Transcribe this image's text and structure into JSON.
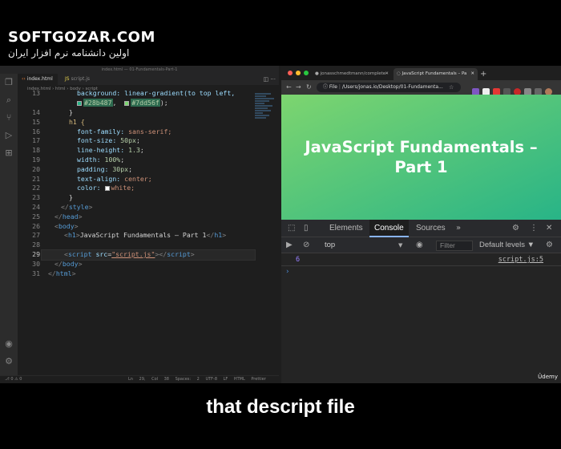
{
  "watermark": {
    "title": "SOFTGOZAR.COM",
    "subtitle": "اولین دانشنامه نرم افزار ایران"
  },
  "editor": {
    "window_title": "index.html — 01-Fundamentals-Part-1",
    "tabs": [
      {
        "label": "index.html",
        "active": true
      },
      {
        "label": "script.js",
        "active": false
      }
    ],
    "breadcrumb": "index.html  ›  html  ›  body  ›  script",
    "lines": [
      {
        "n": "13"
      },
      {
        "n": "14"
      },
      {
        "n": "15"
      },
      {
        "n": "16"
      },
      {
        "n": "17"
      },
      {
        "n": "18"
      },
      {
        "n": "19"
      },
      {
        "n": "20"
      },
      {
        "n": "21"
      },
      {
        "n": "22"
      },
      {
        "n": "23"
      },
      {
        "n": "24"
      },
      {
        "n": "25"
      },
      {
        "n": "26"
      },
      {
        "n": "27"
      },
      {
        "n": "28"
      },
      {
        "n": "29"
      },
      {
        "n": "30"
      },
      {
        "n": "31"
      }
    ],
    "code": {
      "l13a": "background: linear-gradient(to top left,",
      "l13b_c1": "#28b487",
      "l13b_c2": "#7dd56f",
      "l14": "}",
      "l15": "h1 {",
      "l16_p": "font-family: ",
      "l16_v": "sans-serif;",
      "l17_p": "font-size: ",
      "l17_v": "50px",
      "l18_p": "line-height: ",
      "l18_v": "1.3",
      "l19_p": "width: ",
      "l19_v": "100%",
      "l20_p": "padding: ",
      "l20_v": "30px",
      "l21_p": "text-align: ",
      "l21_v": "center;",
      "l22_p": "color: ",
      "l22_v": "white;",
      "l23": "}",
      "l24": "style",
      "l25": "head",
      "l26": "body",
      "l27_tag": "h1",
      "l27_txt": "JavaScript Fundamentals – Part 1",
      "l29_tag": "script",
      "l29_attr": "src",
      "l29_val": "\"script.js\"",
      "l30": "body",
      "l31": "html"
    },
    "status": {
      "left": "⎇ 0 ⚠ 0",
      "right": "Ln 29, Col 38  Spaces: 2  UTF-8  LF  HTML  Prettier"
    }
  },
  "browser": {
    "tabs": [
      {
        "label": "jonasschmedtmann/complete-"
      },
      {
        "label": "JavaScript Fundamentals – Pa"
      }
    ],
    "url_prefix": "File",
    "url": "/Users/jonas.io/Desktop/01-Fundamenta...",
    "page_heading": "JavaScript Fundamentals – Part 1",
    "colors": {
      "gradient_start": "#28b487",
      "gradient_end": "#7dd56f"
    }
  },
  "devtools": {
    "tabs": [
      "Elements",
      "Console",
      "Sources"
    ],
    "active_tab": "Console",
    "context": "top",
    "filter_placeholder": "Filter",
    "levels": "Default levels ▼",
    "log_value": "6",
    "log_source": "script.js:5",
    "prompt": "›"
  },
  "udemy": "Ûdemy",
  "caption": "that descript file"
}
